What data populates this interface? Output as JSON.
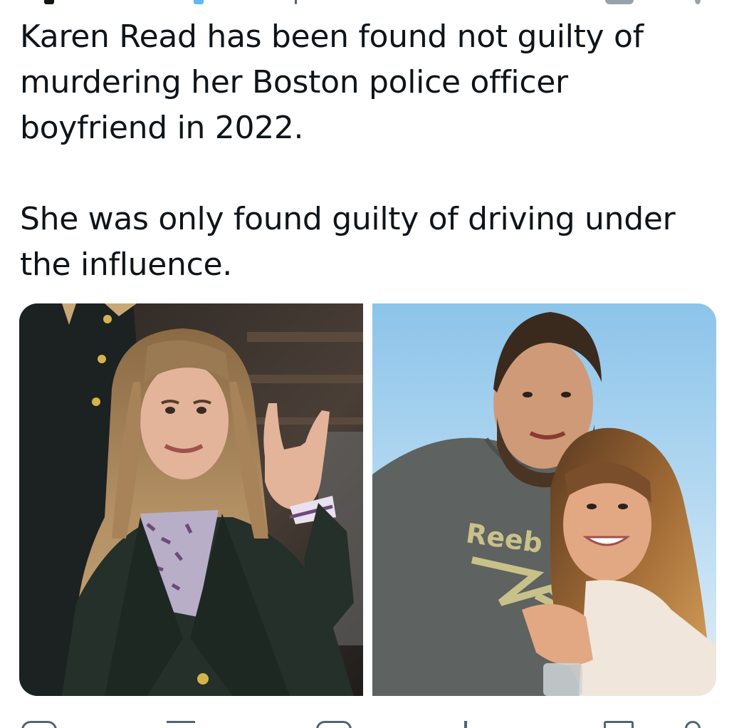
{
  "tweet": {
    "paragraphs": [
      "Karen Read has been found not guilty of murdering her Boston police officer boyfriend in 2022.",
      "She was only found guilty of driving under the influence."
    ]
  },
  "media": [
    {
      "icon": "photo-woman-courthouse"
    },
    {
      "icon": "photo-couple-beach",
      "shirt_text": "Reeb"
    }
  ],
  "actions": [
    {
      "icon": "reply-icon"
    },
    {
      "icon": "retweet-icon"
    },
    {
      "icon": "like-icon"
    },
    {
      "icon": "views-icon"
    },
    {
      "icon": "bookmark-icon"
    },
    {
      "icon": "share-icon"
    }
  ],
  "colors": {
    "text": "#0f1419",
    "icon_gray": "#536471",
    "link_blue": "#1d9bf0"
  }
}
